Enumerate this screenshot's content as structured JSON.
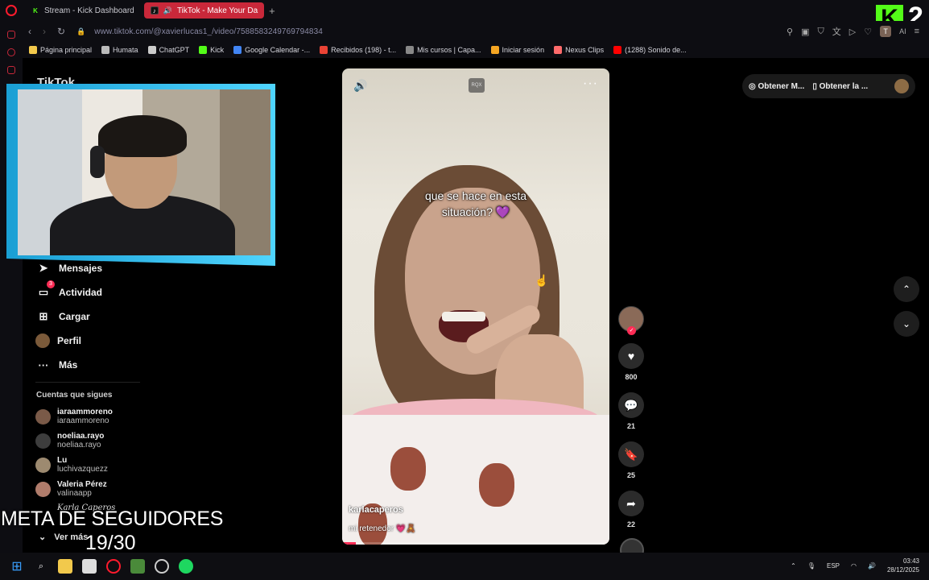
{
  "browser": {
    "tabs": [
      {
        "label": "Stream - Kick Dashboard",
        "active": false
      },
      {
        "label": "TikTok - Make Your Da",
        "active": true
      }
    ],
    "new_tab_symbol": "+",
    "url": "www.tiktok.com/@xavierlucas1_/video/7588583249769794834",
    "profile_initial": "T",
    "ai_label": "AI",
    "bookmarks": [
      {
        "label": "Página principal",
        "color": "#f2c94c"
      },
      {
        "label": "Humata",
        "color": "#bbbbbb"
      },
      {
        "label": "ChatGPT",
        "color": "#cccccc"
      },
      {
        "label": "Kick",
        "color": "#53fc18"
      },
      {
        "label": "Google Calendar -...",
        "color": "#4285f4"
      },
      {
        "label": "Recibidos (198) - t...",
        "color": "#ea4335"
      },
      {
        "label": "Mis cursos | Capa...",
        "color": "#888888"
      },
      {
        "label": "Iniciar sesión",
        "color": "#f5a623"
      },
      {
        "label": "Nexus Clips",
        "color": "#ff6b6b"
      },
      {
        "label": "(1288) Sonido de...",
        "color": "#ff0000"
      }
    ]
  },
  "tiktok": {
    "logo": "TikTok",
    "nav": [
      {
        "label": "Mensajes",
        "icon": "send-icon"
      },
      {
        "label": "Actividad",
        "icon": "inbox-icon",
        "badge": "3"
      },
      {
        "label": "Cargar",
        "icon": "plus-square-icon"
      },
      {
        "label": "Perfil",
        "icon": "avatar"
      },
      {
        "label": "Más",
        "icon": "more-icon"
      }
    ],
    "follows_title": "Cuentas que sigues",
    "follows": [
      {
        "name": "iaraammoreno",
        "handle": "iaraammoreno",
        "color": "#7a5a48"
      },
      {
        "name": "noeliaa.rayo",
        "handle": "noeliaa.rayo",
        "color": "#3d3d3d"
      },
      {
        "name": "Lu",
        "handle": "luchivazquezz",
        "color": "#9d8a70"
      },
      {
        "name": "Valeria Pérez",
        "handle": "valinaapp",
        "color": "#b07c6b"
      }
    ],
    "ver_mas": "Ver más",
    "top_buttons": [
      "Obtener M...",
      "Obtener la ..."
    ]
  },
  "video": {
    "caption_line1": "que se hace en esta",
    "caption_line2": "situación? 💜",
    "watermark": "RQX",
    "author": "karlacaperos",
    "description": "mi retenedor 💗🧸",
    "progress": 0.05,
    "likes": "800",
    "comments": "21",
    "saves": "25",
    "shares": "22"
  },
  "stream_overlay": {
    "goal_label": "META DE SEGUIDORES",
    "goal_count": "19/30",
    "script_name": "Karla Caperos",
    "kick_number": "2"
  },
  "taskbar": {
    "lang": "ESP",
    "time": "03:43",
    "date": "28/12/2025"
  }
}
